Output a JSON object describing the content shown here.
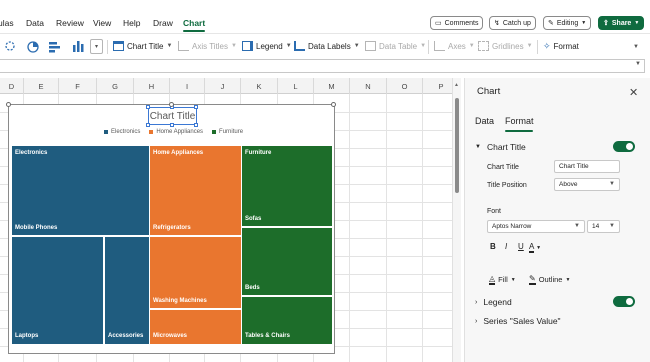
{
  "menu": {
    "items": [
      "ulas",
      "Data",
      "Review",
      "View",
      "Help",
      "Draw",
      "Chart"
    ],
    "active": "Chart"
  },
  "top_buttons": {
    "comments": "Comments",
    "catch_up": "Catch up",
    "editing": "Editing",
    "share": "Share"
  },
  "ribbon": {
    "chart_title": "Chart Title",
    "axis_titles": "Axis Titles",
    "legend": "Legend",
    "data_labels": "Data Labels",
    "data_table": "Data Table",
    "axes": "Axes",
    "gridlines": "Gridlines",
    "format": "Format"
  },
  "grid": {
    "columns": [
      "D",
      "E",
      "F",
      "G",
      "H",
      "I",
      "J",
      "K",
      "L",
      "M",
      "N",
      "O",
      "P"
    ]
  },
  "chart": {
    "title": "Chart Title",
    "legend": [
      {
        "name": "Electronics",
        "color": "#1f5c7f"
      },
      {
        "name": "Home Appliances",
        "color": "#e9762f"
      },
      {
        "name": "Furniture",
        "color": "#1d6d2a"
      }
    ],
    "tiles": [
      {
        "label": "Electronics",
        "color": "#1f5c7f"
      },
      {
        "label": "Mobile Phones",
        "color": "#1f5c7f"
      },
      {
        "label": "Laptops",
        "color": "#1f5c7f"
      },
      {
        "label": "Accessories",
        "color": "#1f5c7f"
      },
      {
        "label": "Home Appliances",
        "color": "#e9762f"
      },
      {
        "label": "Refrigerators",
        "color": "#e9762f"
      },
      {
        "label": "Washing Machines",
        "color": "#e9762f"
      },
      {
        "label": "Microwaves",
        "color": "#e9762f"
      },
      {
        "label": "Furniture",
        "color": "#1d6d2a"
      },
      {
        "label": "Sofas",
        "color": "#1d6d2a"
      },
      {
        "label": "Beds",
        "color": "#1d6d2a"
      },
      {
        "label": "Tables & Chairs",
        "color": "#1d6d2a"
      }
    ]
  },
  "panel": {
    "title": "Chart",
    "tabs": [
      "Data",
      "Format"
    ],
    "active_tab": "Format",
    "chart_title_section": "Chart Title",
    "chart_title_toggle": true,
    "chart_title_label": "Chart Title",
    "chart_title_value": "Chart Title",
    "title_position_label": "Title Position",
    "title_position_value": "Above",
    "font_label": "Font",
    "font_name": "Aptos Narrow",
    "font_size": "14",
    "bold": "B",
    "italic": "I",
    "underline": "U",
    "font_color": "A",
    "fill": "Fill",
    "outline": "Outline",
    "legend_section": "Legend",
    "legend_toggle": true,
    "series_section": "Series \"Sales Value\""
  },
  "colors": {
    "accent": "#0f6b3f",
    "electronics": "#1f5c7f",
    "home_appliances": "#e9762f",
    "furniture": "#1d6d2a"
  }
}
